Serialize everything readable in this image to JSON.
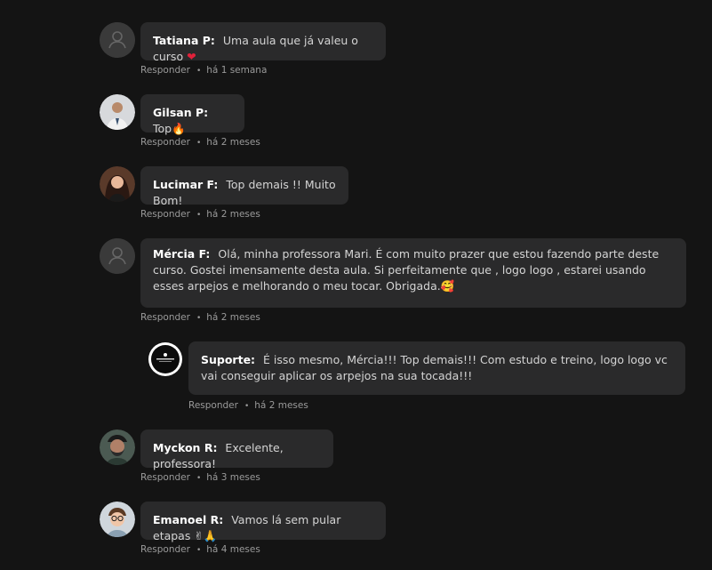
{
  "comments": [
    {
      "author": "Tatiana P:",
      "text": "Uma aula que já valeu o curso",
      "emoji": "❤",
      "reply": "Responder",
      "time": "há 1 semana",
      "avatar": "default-avatar"
    },
    {
      "author": "Gilsan P:",
      "text": "Top",
      "emoji": "🔥",
      "reply": "Responder",
      "time": "há 2 meses",
      "avatar": "photo-man"
    },
    {
      "author": "Lucimar F:",
      "text": "Top demais !! Muito Bom!",
      "reply": "Responder",
      "time": "há 2 meses",
      "avatar": "photo-woman"
    },
    {
      "author": "Mércia F:",
      "text": "Olá, minha professora Mari. É com muito prazer que estou fazendo parte deste curso. Gostei imensamente desta aula. Si perfeitamente que , logo logo , estarei usando esses arpejos e melhorando o meu tocar. Obrigada.",
      "emoji": "🥰",
      "reply": "Responder",
      "time": "há 2 meses",
      "avatar": "default-avatar"
    },
    {
      "author": "Suporte:",
      "text": "É isso mesmo, Mércia!!! Top demais!!! Com estudo e treino, logo logo vc vai conseguir aplicar os arpejos na sua tocada!!!",
      "reply": "Responder",
      "time": "há 2 meses",
      "avatar": "support-logo"
    },
    {
      "author": "Myckon R:",
      "text": "Excelente, professora!",
      "reply": "Responder",
      "time": "há 3 meses",
      "avatar": "photo-man-beard"
    },
    {
      "author": "Emanoel R:",
      "text": "Vamos lá sem pular etapas",
      "emoji": "✌🙏",
      "reply": "Responder",
      "time": "há 4 meses",
      "avatar": "photo-man-glasses"
    }
  ],
  "colors": {
    "background": "#141414",
    "bubble": "#2a2a2b",
    "meta": "#9a9a9a"
  }
}
